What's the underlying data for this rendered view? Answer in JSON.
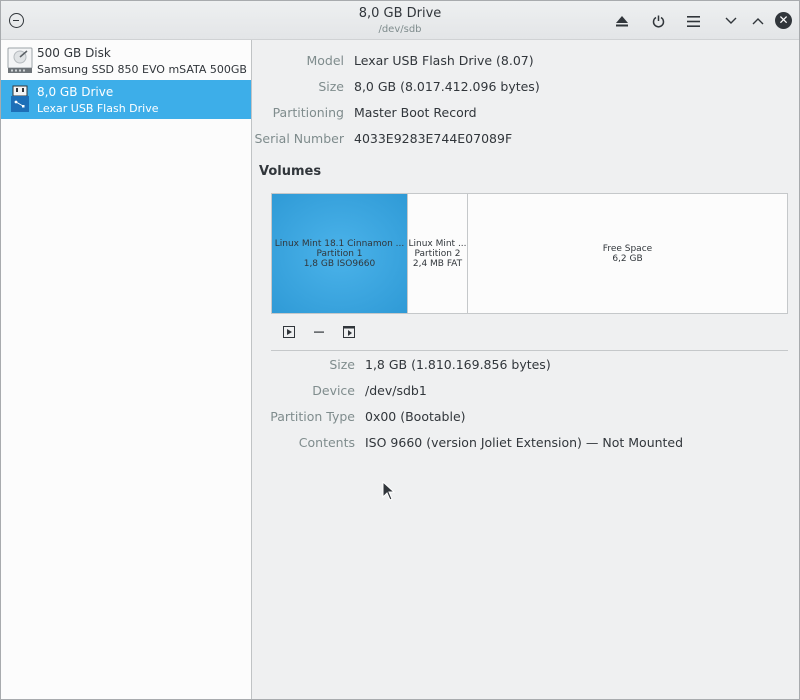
{
  "titlebar": {
    "title": "8,0 GB Drive",
    "subtitle": "/dev/sdb"
  },
  "sidebar": {
    "items": [
      {
        "name": "500 GB Disk",
        "desc": "Samsung SSD 850 EVO mSATA 500GB",
        "icon": "hdd-icon",
        "selected": false
      },
      {
        "name": "8,0 GB Drive",
        "desc": "Lexar USB Flash Drive",
        "icon": "usb-drive-icon",
        "selected": true
      }
    ]
  },
  "drive": {
    "model_label": "Model",
    "model": "Lexar USB Flash Drive (8.07)",
    "size_label": "Size",
    "size": "8,0 GB (8.017.412.096 bytes)",
    "partitioning_label": "Partitioning",
    "partitioning": "Master Boot Record",
    "serial_label": "Serial Number",
    "serial": "4033E9283E744E07089F"
  },
  "volumes": {
    "title": "Volumes",
    "partitions": [
      {
        "line1": "Linux Mint 18.1 Cinnamon ...",
        "line2": "Partition 1",
        "line3": "1,8 GB ISO9660",
        "selected": true
      },
      {
        "line1": "Linux Mint ...",
        "line2": "Partition 2",
        "line3": "2,4 MB FAT",
        "selected": false
      },
      {
        "line1": "Free Space",
        "line2": "6,2 GB",
        "selected": false
      }
    ]
  },
  "partition_details": {
    "size_label": "Size",
    "size": "1,8 GB (1.810.169.856 bytes)",
    "device_label": "Device",
    "device": "/dev/sdb1",
    "type_label": "Partition Type",
    "type": "0x00 (Bootable)",
    "contents_label": "Contents",
    "contents": "ISO 9660 (version Joliet Extension) — Not Mounted"
  },
  "colors": {
    "selection": "#3daee9",
    "text": "#31363b",
    "muted": "#7f8c8d"
  }
}
